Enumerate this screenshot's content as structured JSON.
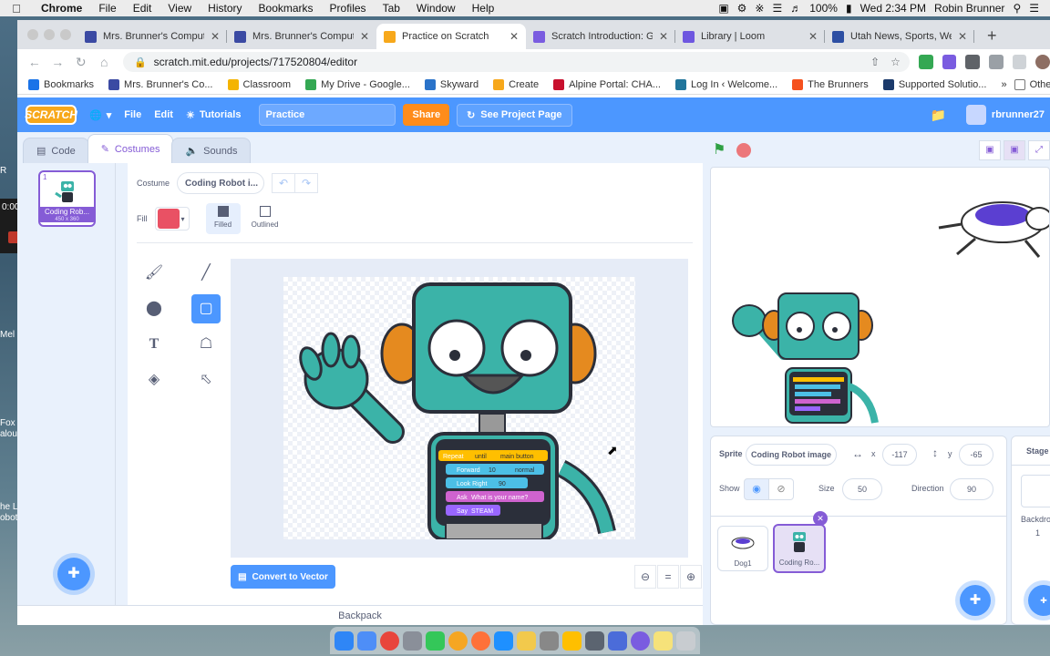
{
  "menubar": {
    "app": "Chrome",
    "items": [
      "File",
      "Edit",
      "View",
      "History",
      "Bookmarks",
      "Profiles",
      "Tab",
      "Window",
      "Help"
    ],
    "battery": "100%",
    "clock": "Wed 2:34 PM",
    "user": "Robin Brunner"
  },
  "desktop": {
    "fragments": [
      "R",
      "Mel",
      "Fox a",
      "alou",
      "he L",
      "obot"
    ],
    "recorder_time": "0:00"
  },
  "browser": {
    "tabs": [
      {
        "title": "Mrs. Brunner's Computer",
        "color": "#3b4aa3"
      },
      {
        "title": "Mrs. Brunner's Computer",
        "color": "#3b4aa3"
      },
      {
        "title": "Practice on Scratch",
        "color": "#f7a81b"
      },
      {
        "title": "Scratch Introduction: Get",
        "color": "#7a5ce0"
      },
      {
        "title": "Library | Loom",
        "color": "#6e57e0"
      },
      {
        "title": "Utah News, Sports, Weat",
        "color": "#2d4fa3"
      }
    ],
    "active_tab": 2,
    "url": "scratch.mit.edu/projects/717520804/editor",
    "bookmarks": [
      {
        "label": "Bookmarks",
        "color": "#1a73e8"
      },
      {
        "label": "Mrs. Brunner's Co...",
        "color": "#3b4aa3"
      },
      {
        "label": "Classroom",
        "color": "#f4b400"
      },
      {
        "label": "My Drive - Google...",
        "color": "#34a853"
      },
      {
        "label": "Skyward",
        "color": "#2a73c9"
      },
      {
        "label": "Create",
        "color": "#f7a81b"
      },
      {
        "label": "Alpine Portal: CHA...",
        "color": "#c8102e"
      },
      {
        "label": "Log In ‹ Welcome...",
        "color": "#21759b"
      },
      {
        "label": "The Brunners",
        "color": "#f5511e"
      },
      {
        "label": "Supported Solutio...",
        "color": "#1b3a6b"
      }
    ],
    "other_bookmarks": "Other Bookmar"
  },
  "scratch": {
    "logo": "SCRATCH",
    "menu": {
      "file": "File",
      "edit": "Edit",
      "tutorials": "Tutorials"
    },
    "project_title": "Practice",
    "share": "Share",
    "see_project": "See Project Page",
    "username": "rbrunner27",
    "tabs": {
      "code": "Code",
      "costumes": "Costumes",
      "sounds": "Sounds"
    },
    "costume": {
      "number": "1",
      "name": "Coding Rob...",
      "size": "450 x 360",
      "field_label": "Costume",
      "field_value": "Coding Robot i..."
    },
    "fill": {
      "label": "Fill",
      "color": "#e95164",
      "filled": "Filled",
      "outlined": "Outlined"
    },
    "robot_code": {
      "repeat": "Repeat",
      "until": "until",
      "main_button": "main button",
      "forward": "Forward",
      "forward_val": "10",
      "normal": "normal",
      "look_right": "Look Right",
      "look_val": "90",
      "ask": "Ask",
      "ask_text": "What is your name?",
      "say": "Say",
      "say_text": "STEAM"
    },
    "convert": "Convert to Vector",
    "zoom_reset": "=",
    "backpack": "Backpack",
    "sprite_info": {
      "sprite_label": "Sprite",
      "sprite_name": "Coding Robot image",
      "x_label": "x",
      "x": "-117",
      "y_label": "y",
      "y": "-65",
      "show_label": "Show",
      "size_label": "Size",
      "size": "50",
      "direction_label": "Direction",
      "direction": "90"
    },
    "sprites": [
      {
        "name": "Dog1",
        "selected": false
      },
      {
        "name": "Coding Ro...",
        "selected": true
      }
    ],
    "stage_pane": {
      "title": "Stage",
      "backdrops_label": "Backdrops",
      "backdrops_count": "1"
    }
  }
}
